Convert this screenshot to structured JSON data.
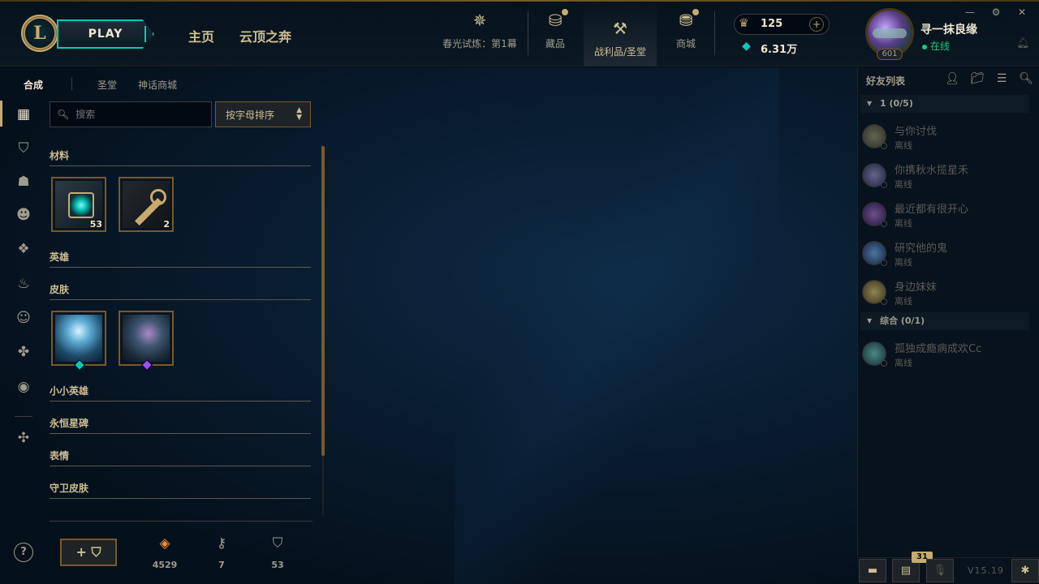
{
  "topbar": {
    "logo_letter": "L",
    "play_label": "PLAY",
    "nav_links": [
      "主页",
      "云顶之奔"
    ],
    "nav_items": [
      {
        "label": "春光试炼：第1幕",
        "icon": "event-star-icon"
      },
      {
        "label": "藏品",
        "icon": "collection-bag-icon"
      },
      {
        "label": "战利品/圣堂",
        "icon": "loot-hammer-icon"
      },
      {
        "label": "商城",
        "icon": "coins-store-icon"
      }
    ],
    "rp_value": "125",
    "rp_plus": "+",
    "be_value": "6.31万",
    "summoner_name": "寻一抹良缘",
    "summoner_status": "在线",
    "summoner_level": "601",
    "window_controls": [
      "—",
      "⚙",
      "✕"
    ]
  },
  "loot": {
    "subtabs": [
      "合成",
      "圣堂",
      "神话商城"
    ],
    "search_placeholder": "搜索",
    "sort_label": "按字母排序",
    "sections": [
      "材料",
      "英雄",
      "皮肤",
      "小小英雄",
      "永恒星碑",
      "表情",
      "守卫皮肤"
    ],
    "materials": [
      {
        "name": "hextech-chest",
        "count": "53"
      },
      {
        "name": "hextech-key",
        "count": "2"
      }
    ],
    "skins": [
      {
        "name": "skin-shard-1",
        "gem_color": "#0ac8b9"
      },
      {
        "name": "skin-shard-2",
        "gem_color": "#9b4dff"
      }
    ],
    "craft_label": "+ ⛉",
    "currencies": [
      {
        "icon": "orange-essence-icon",
        "value": "4529",
        "color": "#f08c3c"
      },
      {
        "icon": "key-fragment-icon",
        "value": "7",
        "color": "#a09b8c"
      },
      {
        "icon": "chest-icon",
        "value": "53",
        "color": "#a09b8c"
      }
    ]
  },
  "rail": {
    "icons": [
      "grid-icon",
      "chest-icon",
      "champion-helmet-icon",
      "skin-mask-icon",
      "ward-icon",
      "totem-icon",
      "emote-icon",
      "tft-icon",
      "profile-icon",
      "eternals-icon"
    ]
  },
  "friends": {
    "title": "好友列表",
    "groups": [
      {
        "label": "1 (0/5)"
      },
      {
        "label": "综合 (0/1)"
      }
    ],
    "list": [
      {
        "name": "与你讨伐",
        "status": "离线",
        "avatar": "#6a6a4a"
      },
      {
        "name": "你携秋水揽星禾",
        "status": "离线",
        "avatar": "#5a5a8a"
      },
      {
        "name": "最近都有很开心",
        "status": "离线",
        "avatar": "#6a4a8a"
      },
      {
        "name": "研究他的鬼",
        "status": "离线",
        "avatar": "#3a6a9a"
      },
      {
        "name": "身边妹妹",
        "status": "离线",
        "avatar": "#8a7a3a"
      },
      {
        "name": "孤独成瘾病成欢Cc",
        "status": "离线",
        "avatar": "#3a7a7a"
      }
    ],
    "message_count": "31",
    "version": "V15.19"
  }
}
